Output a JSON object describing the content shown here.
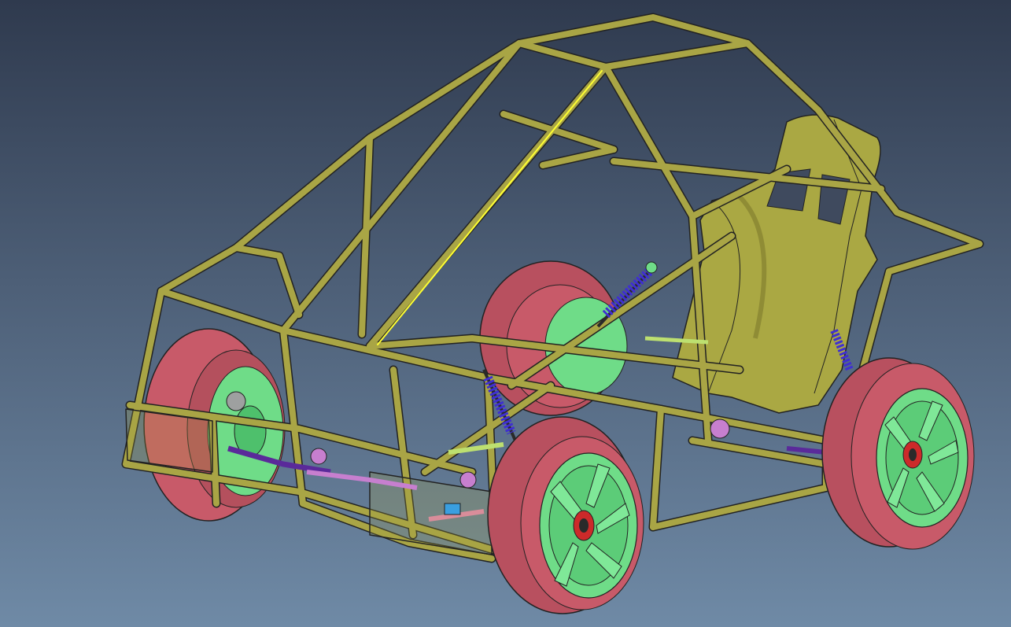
{
  "viewport": {
    "background_top": "#2f3a4e",
    "background_bottom": "#6f8aa6"
  },
  "model": {
    "colors": {
      "frame": "#a9a545",
      "frame_edge": "#222222",
      "selected_edge": "#ffff33",
      "tire": "#c85a69",
      "rim": "#6fdc88",
      "seat": "#aaa843",
      "shock_spring": "#3f2fd1",
      "suspension_arm": "#5a2a9a",
      "hub": "#c77fcf",
      "link": "#d98d9a"
    },
    "parts": [
      "tubular-frame",
      "roll-cage",
      "racing-seat",
      "front-left-wheel",
      "front-right-wheel",
      "rear-left-wheel",
      "rear-right-wheel",
      "front-shock",
      "rear-shock",
      "suspension-arms"
    ]
  }
}
